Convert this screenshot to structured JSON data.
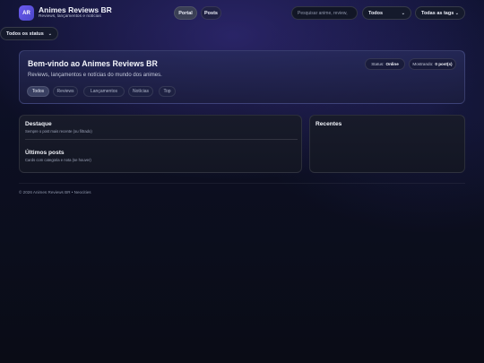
{
  "header": {
    "logo_text": "AR",
    "title": "Animes Reviews BR",
    "subtitle": "Reviews, lançamentos e notícias",
    "nav": {
      "portal": "Portal",
      "posts": "Posts"
    },
    "search_placeholder": "Pesquisar anime, review,",
    "category_select": "Todos",
    "tags_select": "Todas as tags",
    "status_select": "Todos os status",
    "chevron": "⌄"
  },
  "hero": {
    "title": "Bem-vindo ao Animes Reviews BR",
    "subtitle": "Reviews, lançamentos e notícias do mundo dos animes.",
    "status_label": "Status:",
    "status_value": "Online",
    "showing_label": "Mostrando:",
    "showing_value": "0 post(s)",
    "chips": [
      "Todos",
      "Reviews",
      "Lançamentos",
      "Notícias",
      "Top"
    ],
    "active_chip": "Todos"
  },
  "main": {
    "destaque_title": "Destaque",
    "destaque_sub": "Sempre o post mais recente (ou filtrado)",
    "ultimos_title": "Últimos posts",
    "ultimos_sub": "Cards com categoria e nota (se houver)"
  },
  "side": {
    "recentes_title": "Recentes"
  },
  "footer": {
    "text": "© 2026 Animes Reviews BR • Neocities"
  },
  "colors": {
    "accent": "#5b52e0",
    "background": "#0c0f22"
  }
}
